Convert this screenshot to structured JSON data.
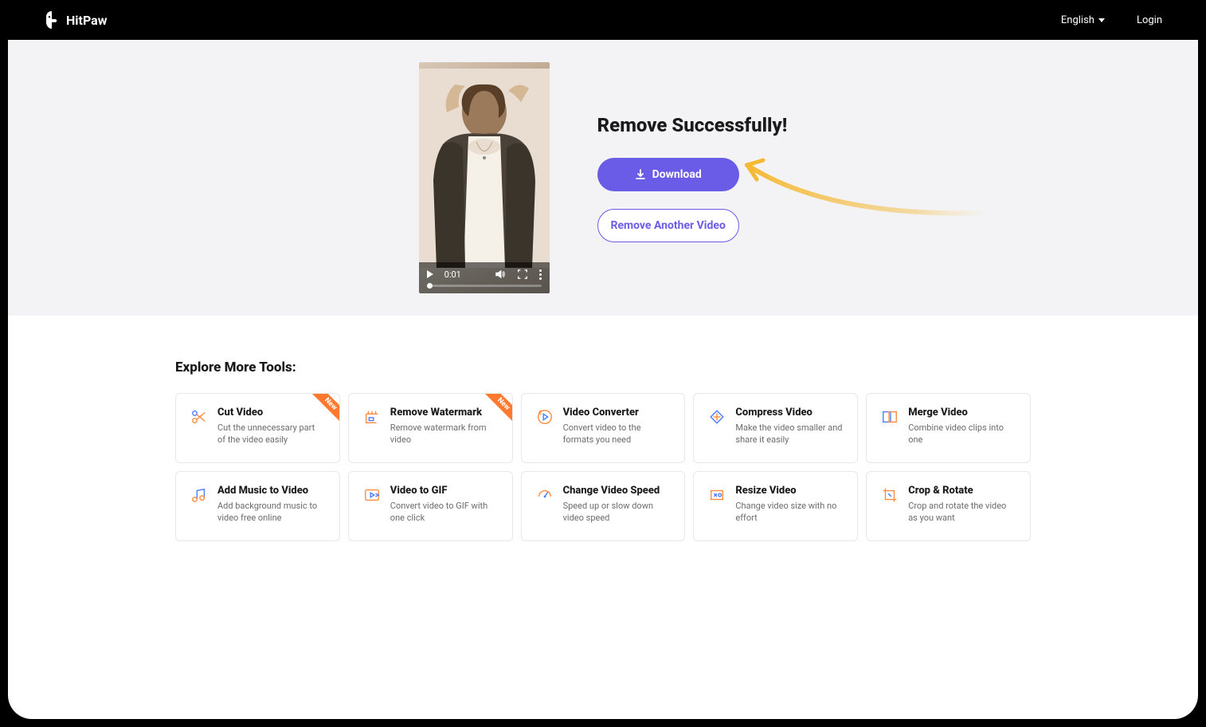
{
  "header": {
    "brand": "HitPaw",
    "language": "English",
    "login": "Login"
  },
  "hero": {
    "video_time": "0:01",
    "title": "Remove Successfully!",
    "download_label": "Download",
    "remove_another_label": "Remove Another Video"
  },
  "tools_section": {
    "heading": "Explore More Tools:",
    "new_badge": "New",
    "cards": [
      {
        "title": "Cut Video",
        "desc": "Cut the unnecessary part of the video easily",
        "new": true
      },
      {
        "title": "Remove Watermark",
        "desc": "Remove watermark from video",
        "new": true
      },
      {
        "title": "Video Converter",
        "desc": "Convert video to the formats you need",
        "new": false
      },
      {
        "title": "Compress Video",
        "desc": "Make the video smaller and share it easily",
        "new": false
      },
      {
        "title": "Merge Video",
        "desc": "Combine video clips into one",
        "new": false
      },
      {
        "title": "Add Music to Video",
        "desc": "Add background music to video free online",
        "new": false
      },
      {
        "title": "Video to GIF",
        "desc": "Convert video to GIF with one click",
        "new": false
      },
      {
        "title": "Change Video Speed",
        "desc": "Speed up or slow down video speed",
        "new": false
      },
      {
        "title": "Resize Video",
        "desc": "Change video size with no effort",
        "new": false
      },
      {
        "title": "Crop & Rotate",
        "desc": "Crop and rotate the video as you want",
        "new": false
      }
    ]
  }
}
